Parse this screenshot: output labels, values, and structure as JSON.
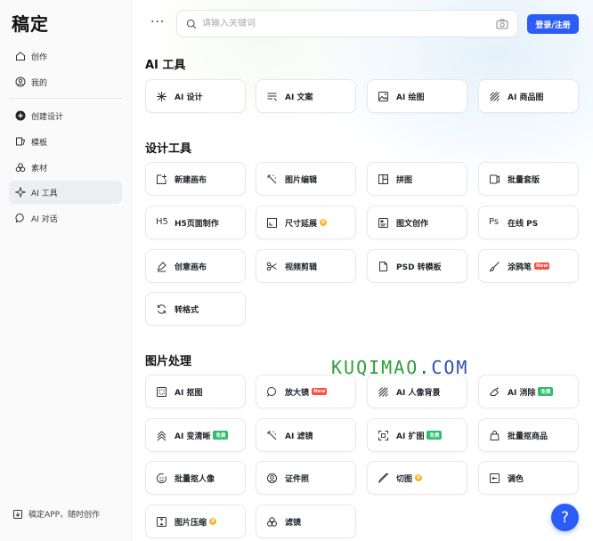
{
  "app": {
    "logo": "稿定"
  },
  "sidebar": {
    "items": [
      {
        "label": "创作",
        "icon": "home-icon"
      },
      {
        "label": "我的",
        "icon": "user-icon"
      },
      {
        "label": "创建设计",
        "icon": "plus-circle-icon"
      },
      {
        "label": "模板",
        "icon": "template-icon"
      },
      {
        "label": "素材",
        "icon": "shapes-icon"
      },
      {
        "label": "AI 工具",
        "icon": "sparkle-icon",
        "active": true
      },
      {
        "label": "AI 对话",
        "icon": "chat-icon"
      }
    ],
    "app_link": "稿定APP，随时创作"
  },
  "header": {
    "more": "···",
    "search_placeholder": "请输入关键词",
    "login_label": "登录/注册"
  },
  "sections": [
    {
      "title": "AI 工具",
      "items": [
        {
          "label": "AI 设计",
          "icon": "sparkle-icon"
        },
        {
          "label": "AI 文案",
          "icon": "text-lines-icon"
        },
        {
          "label": "AI 绘图",
          "icon": "image-icon"
        },
        {
          "label": "AI 商品图",
          "icon": "hatch-icon"
        }
      ]
    },
    {
      "title": "设计工具",
      "items": [
        {
          "label": "新建画布",
          "icon": "new-canvas-icon"
        },
        {
          "label": "图片编辑",
          "icon": "magic-wand-icon"
        },
        {
          "label": "拼图",
          "icon": "collage-icon"
        },
        {
          "label": "批量套版",
          "icon": "batch-icon"
        },
        {
          "label": "H5页面制作",
          "icon": "h5-icon"
        },
        {
          "label": "尺寸延展",
          "icon": "resize-icon",
          "badge": "vip"
        },
        {
          "label": "图文创作",
          "icon": "article-icon"
        },
        {
          "label": "在线 PS",
          "icon": "ps-icon"
        },
        {
          "label": "创意画布",
          "icon": "creative-icon"
        },
        {
          "label": "视频剪辑",
          "icon": "scissors-icon"
        },
        {
          "label": "PSD 转模板",
          "icon": "file-icon"
        },
        {
          "label": "涂鸦笔",
          "icon": "brush-icon",
          "badge": "new"
        },
        {
          "label": "转格式",
          "icon": "convert-icon"
        }
      ]
    },
    {
      "title": "图片处理",
      "items": [
        {
          "label": "AI 抠图",
          "icon": "cutout-icon"
        },
        {
          "label": "放大镜",
          "icon": "magnifier-icon",
          "badge": "new"
        },
        {
          "label": "AI 人像背景",
          "icon": "hatch-icon"
        },
        {
          "label": "AI 消除",
          "icon": "eraser-icon",
          "badge": "free"
        },
        {
          "label": "AI 变清晰",
          "icon": "sharpen-icon",
          "badge": "free"
        },
        {
          "label": "AI 滤镜",
          "icon": "magic-wand-icon"
        },
        {
          "label": "AI 扩图",
          "icon": "expand-icon",
          "badge": "free"
        },
        {
          "label": "批量抠商品",
          "icon": "bag-icon"
        },
        {
          "label": "批量抠人像",
          "icon": "face-icon"
        },
        {
          "label": "证件照",
          "icon": "id-photo-icon"
        },
        {
          "label": "切图",
          "icon": "knife-icon",
          "badge": "vip"
        },
        {
          "label": "调色",
          "icon": "adjust-icon"
        },
        {
          "label": "图片压缩",
          "icon": "compress-icon",
          "badge": "vip"
        },
        {
          "label": "滤镜",
          "icon": "filter-icon"
        }
      ]
    }
  ],
  "badges": {
    "new": "New",
    "free": "免费",
    "vip": "V"
  },
  "watermark": {
    "part1": "KUQIMAO",
    "part2": ".COM"
  },
  "help": {
    "label": "?"
  }
}
